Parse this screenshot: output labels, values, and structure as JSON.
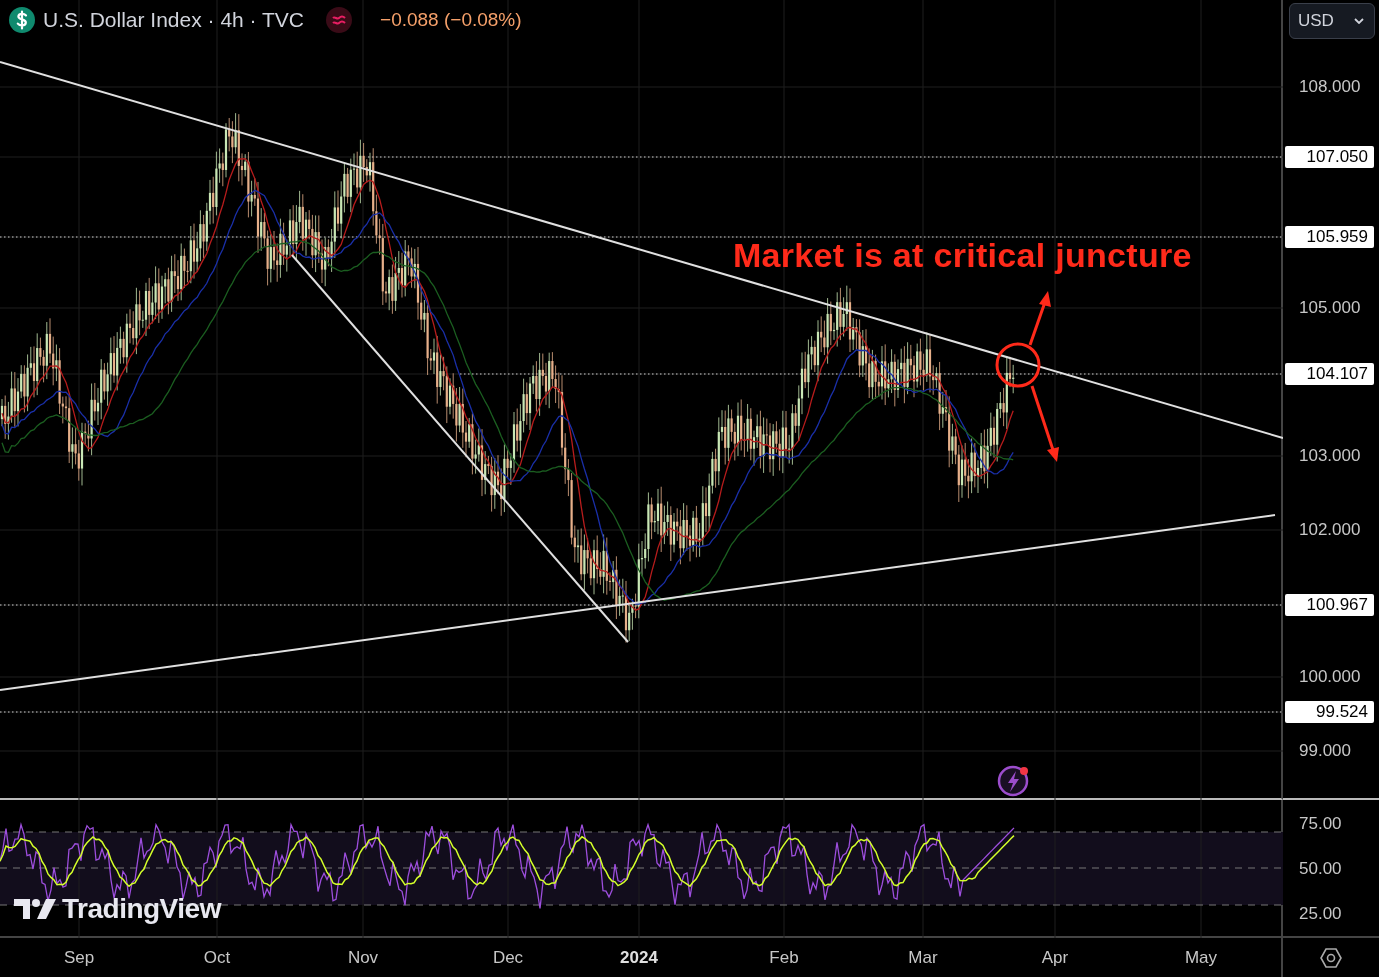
{
  "header": {
    "title": "U.S. Dollar Index · 4h · TVC",
    "change": "−0.088 (−0.08%)"
  },
  "currency_select": {
    "value": "USD"
  },
  "annotation": {
    "text": "Market is at critical juncture"
  },
  "price_axis": [
    {
      "label": "108.000",
      "kind": "tick"
    },
    {
      "label": "107.050",
      "kind": "level"
    },
    {
      "label": "105.959",
      "kind": "level"
    },
    {
      "label": "105.000",
      "kind": "tick"
    },
    {
      "label": "104.107",
      "kind": "level"
    },
    {
      "label": "103.000",
      "kind": "tick"
    },
    {
      "label": "102.000",
      "kind": "tick"
    },
    {
      "label": "100.967",
      "kind": "level"
    },
    {
      "label": "100.000",
      "kind": "tick"
    },
    {
      "label": "99.524",
      "kind": "level"
    },
    {
      "label": "99.000",
      "kind": "tick"
    }
  ],
  "rsi_axis": [
    "75.00",
    "50.00",
    "25.00"
  ],
  "time_axis": [
    {
      "label": "Sep",
      "bold": false
    },
    {
      "label": "Oct",
      "bold": false
    },
    {
      "label": "Nov",
      "bold": false
    },
    {
      "label": "Dec",
      "bold": false
    },
    {
      "label": "2024",
      "bold": true
    },
    {
      "label": "Feb",
      "bold": false
    },
    {
      "label": "Mar",
      "bold": false
    },
    {
      "label": "Apr",
      "bold": false
    },
    {
      "label": "May",
      "bold": false
    }
  ],
  "brand": {
    "text": "TradingView"
  }
}
